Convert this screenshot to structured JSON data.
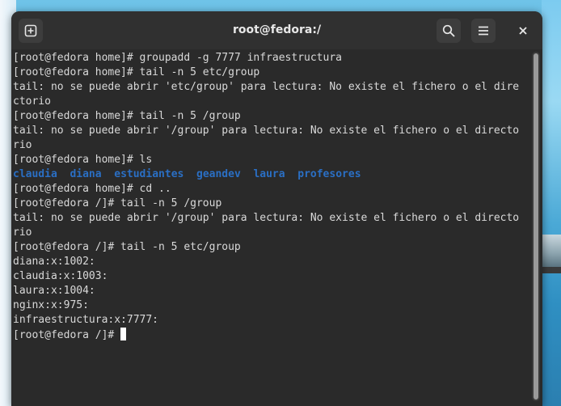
{
  "window": {
    "title": "root@fedora:/",
    "buttons": {
      "new_tab_icon": "new-tab-icon",
      "search_icon": "search-icon",
      "menu_icon": "hamburger-menu-icon",
      "close_icon": "close-icon"
    }
  },
  "terminal": {
    "lines": [
      "[root@fedora home]# groupadd -g 7777 infraestructura",
      "[root@fedora home]# tail -n 5 etc/group",
      "tail: no se puede abrir 'etc/group' para lectura: No existe el fichero o el dire",
      "ctorio",
      "[root@fedora home]# tail -n 5 /group",
      "tail: no se puede abrir '/group' para lectura: No existe el fichero o el directo",
      "rio",
      "[root@fedora home]# ls"
    ],
    "ls_output": [
      "claudia",
      "diana",
      "estudiantes",
      "geandev",
      "laura",
      "profesores"
    ],
    "lines_after": [
      "[root@fedora home]# cd ..",
      "[root@fedora /]# tail -n 5 /group",
      "tail: no se puede abrir '/group' para lectura: No existe el fichero o el directo",
      "rio",
      "[root@fedora /]# tail -n 5 etc/group",
      "diana:x:1002:",
      "claudia:x:1003:",
      "laura:x:1004:",
      "nginx:x:975:",
      "infraestructura:x:7777:"
    ],
    "prompt": "[root@fedora /]# ",
    "colors": {
      "background": "#2a2a2a",
      "text": "#d9d9d9",
      "directory": "#2a6fc4"
    }
  }
}
